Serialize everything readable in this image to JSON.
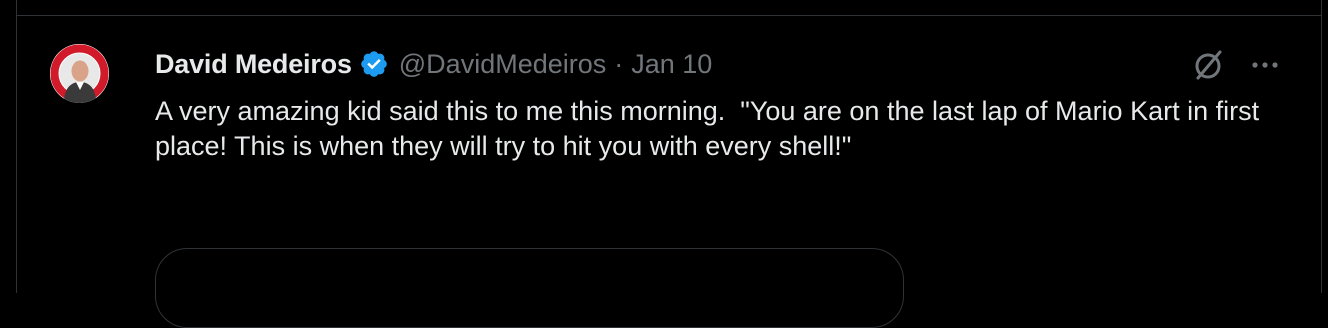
{
  "post": {
    "author": {
      "display_name": "David Medeiros",
      "handle": "@DavidMedeiros",
      "verified": true,
      "avatar": "profile-photo-with-logo"
    },
    "separator": "·",
    "date": "Jan 10",
    "text": "A very amazing kid said this to me this morning.  \"You are on the last lap of Mario Kart in first place! This is when they will try to hit you with every shell!\"",
    "actions": {
      "grok_icon": "grok-slash-circle-icon",
      "more_icon": "more-horizontal-icon"
    }
  },
  "theme": {
    "background": "#000000",
    "text": "#e7e9ea",
    "secondary": "#71767b",
    "border": "#2f3336",
    "verified_blue": "#1d9bf0"
  }
}
